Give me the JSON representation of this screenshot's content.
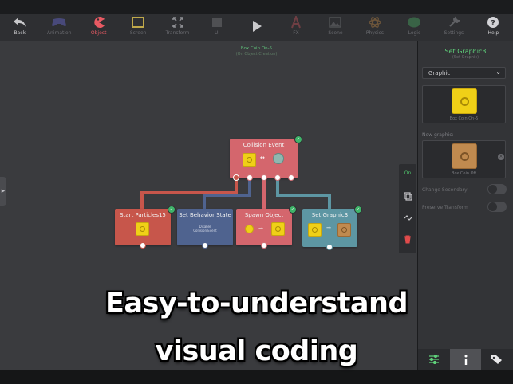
{
  "toolbar": {
    "items": [
      {
        "label": "Back",
        "icon": "back-arrow-icon"
      },
      {
        "label": "Animation",
        "icon": "gamepad-icon"
      },
      {
        "label": "Object",
        "icon": "pacman-icon"
      },
      {
        "label": "Screen",
        "icon": "screen-icon"
      },
      {
        "label": "Transform",
        "icon": "transform-icon"
      },
      {
        "label": "UI",
        "icon": "ui-icon"
      },
      {
        "label": "",
        "icon": "play-icon"
      },
      {
        "label": "FX",
        "icon": "fx-icon"
      },
      {
        "label": "Scene",
        "icon": "image-icon"
      },
      {
        "label": "Physics",
        "icon": "atom-icon"
      },
      {
        "label": "Logic",
        "icon": "brain-icon"
      },
      {
        "label": "Settings",
        "icon": "wrench-icon"
      },
      {
        "label": "Help",
        "icon": "help-icon"
      }
    ],
    "accent": "#e85a63"
  },
  "scene": {
    "title": "Box Coin On-5",
    "subtitle": "(On Object Creation)"
  },
  "nodes": {
    "collision": {
      "title": "Collision Event"
    },
    "particles": {
      "title": "Start Particles15"
    },
    "behavior": {
      "title": "Set Behavior State",
      "detail_1": "Disable",
      "detail_2": "Collision Event"
    },
    "spawn": {
      "title": "Spawn Object"
    },
    "graphic": {
      "title": "Set Graphic3"
    }
  },
  "node_colors": {
    "red": "#d4666d",
    "brick": "#c7564b",
    "blue": "#4f638f",
    "teal": "#5d96a3"
  },
  "tool_column": {
    "on_label": "On"
  },
  "panel": {
    "title": "Set Graphic3",
    "subtitle": "(Set Graphic)",
    "select_value": "Graphic",
    "current_caption": "Box Coin On-5",
    "new_graphic_label": "New graphic:",
    "new_caption": "Box Coin Off",
    "change_secondary_label": "Change Secondary",
    "preserve_transform_label": "Preserve Transform",
    "tabs": [
      {
        "icon": "sliders-icon"
      },
      {
        "icon": "info-icon"
      },
      {
        "icon": "tags-icon"
      }
    ]
  },
  "caption": {
    "line1": "Easy-to-understand",
    "line2": "visual coding"
  }
}
